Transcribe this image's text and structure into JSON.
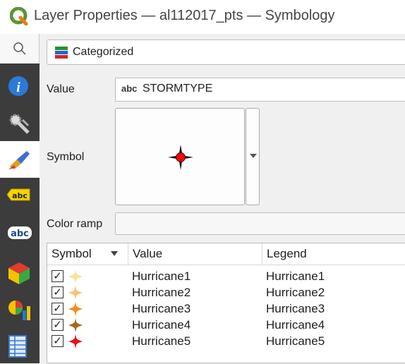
{
  "window": {
    "title": "Layer Properties — al112017_pts — Symbology"
  },
  "sidebar": {
    "items": [
      {
        "name": "search",
        "icon": "search-icon"
      },
      {
        "name": "information",
        "icon": "info-icon"
      },
      {
        "name": "source",
        "icon": "source-settings-icon"
      },
      {
        "name": "symbology",
        "icon": "paint-brush-icon",
        "active": true
      },
      {
        "name": "labels",
        "icon": "labels-abc-icon"
      },
      {
        "name": "masks",
        "icon": "abc-mask-icon"
      },
      {
        "name": "3d-view",
        "icon": "3d-cube-icon"
      },
      {
        "name": "diagrams",
        "icon": "diagram-icon"
      },
      {
        "name": "fields",
        "icon": "fields-table-icon"
      }
    ]
  },
  "symbology": {
    "renderer": "Categorized",
    "value_label": "Value",
    "value_type_badge": "abc",
    "value_field": "STORMTYPE",
    "symbol_label": "Symbol",
    "color_ramp_label": "Color ramp",
    "symbol_color": "#ff0000"
  },
  "table": {
    "headers": {
      "symbol": "Symbol",
      "value": "Value",
      "legend": "Legend"
    },
    "rows": [
      {
        "checked": true,
        "value": "Hurricane1",
        "legend": "Hurricane1",
        "color": "#f5e39a"
      },
      {
        "checked": true,
        "value": "Hurricane2",
        "legend": "Hurricane2",
        "color": "#f7c27a"
      },
      {
        "checked": true,
        "value": "Hurricane3",
        "legend": "Hurricane3",
        "color": "#f28c1e"
      },
      {
        "checked": true,
        "value": "Hurricane4",
        "legend": "Hurricane4",
        "color": "#a8661f"
      },
      {
        "checked": true,
        "value": "Hurricane5",
        "legend": "Hurricane5",
        "color": "#e8101a"
      }
    ]
  }
}
